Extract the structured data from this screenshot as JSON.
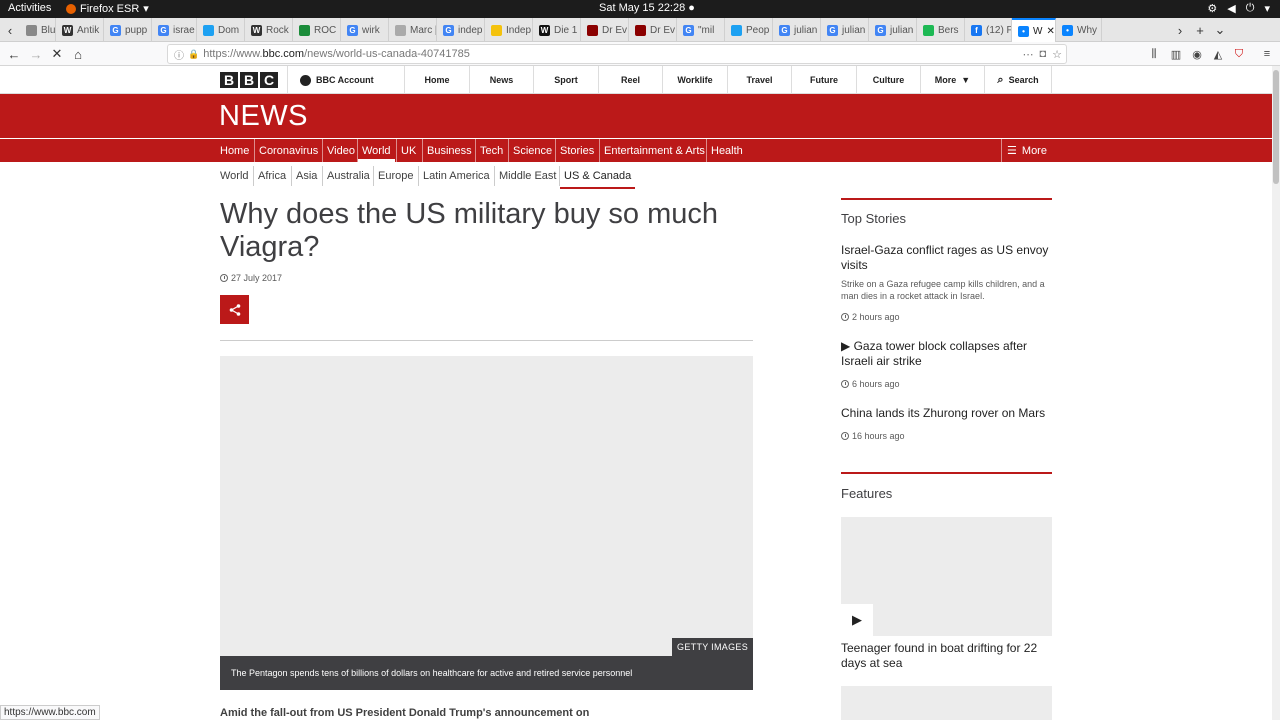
{
  "system": {
    "activities": "Activities",
    "app_name": "Firefox ESR",
    "clock": "Sat May 15  22:28"
  },
  "tabs": [
    {
      "label": "Blut"
    },
    {
      "label": "Antik"
    },
    {
      "label": "pupp"
    },
    {
      "label": "israe"
    },
    {
      "label": "Dom"
    },
    {
      "label": "Rock"
    },
    {
      "label": "ROC"
    },
    {
      "label": "wirk"
    },
    {
      "label": "Marc [L/"
    },
    {
      "label": "indep"
    },
    {
      "label": "Indep"
    },
    {
      "label": "Die 1"
    },
    {
      "label": "Dr Ev"
    },
    {
      "label": "Dr Ev"
    },
    {
      "label": "\"mil"
    },
    {
      "label": "Peop"
    },
    {
      "label": "julian"
    },
    {
      "label": "julian"
    },
    {
      "label": "julian"
    },
    {
      "label": "Bers"
    },
    {
      "label": "(12) F"
    },
    {
      "label": "W"
    },
    {
      "label": "Why"
    }
  ],
  "url": {
    "prefix": "https://www.",
    "host": "bbc.com",
    "path": "/news/world-us-canada-40741785"
  },
  "bbc": {
    "logo": [
      "B",
      "B",
      "C"
    ],
    "account": "BBC Account",
    "nav": [
      "Home",
      "News",
      "Sport",
      "Reel",
      "Worklife",
      "Travel",
      "Future",
      "Culture"
    ],
    "more": "More",
    "search": "Search",
    "news_word": "NEWS"
  },
  "news_nav": [
    "Home",
    "Coronavirus",
    "Video",
    "World",
    "UK",
    "Business",
    "Tech",
    "Science",
    "Stories",
    "Entertainment & Arts",
    "Health"
  ],
  "news_nav_more": "More",
  "sub_nav": [
    "World",
    "Africa",
    "Asia",
    "Australia",
    "Europe",
    "Latin America",
    "Middle East",
    "US & Canada"
  ],
  "article": {
    "headline": "Why does the US military buy so much Viagra?",
    "date": "27 July 2017",
    "credit": "GETTY IMAGES",
    "caption": "The Pentagon spends tens of billions of dollars on healthcare for active and retired service personnel",
    "lede": "Amid the fall-out from US President Donald Trump's announcement on"
  },
  "sidebar": {
    "top_stories_title": "Top Stories",
    "stories": [
      {
        "title": "Israel-Gaza conflict rages as US envoy visits",
        "summary": "Strike on a Gaza refugee camp kills children, and a man dies in a rocket attack in Israel.",
        "time": "2 hours ago"
      },
      {
        "title": "Gaza tower block collapses after Israeli air strike",
        "time": "6 hours ago"
      },
      {
        "title": "China lands its Zhurong rover on Mars",
        "time": "16 hours ago"
      }
    ],
    "features_title": "Features",
    "feature_title": "Teenager found in boat drifting for 22 days at sea"
  },
  "status_url": "https://www.bbc.com",
  "colors": {
    "bbc_red": "#bb1919",
    "dark_text": "#3f3f42",
    "firefox_blue": "#0a84ff"
  }
}
